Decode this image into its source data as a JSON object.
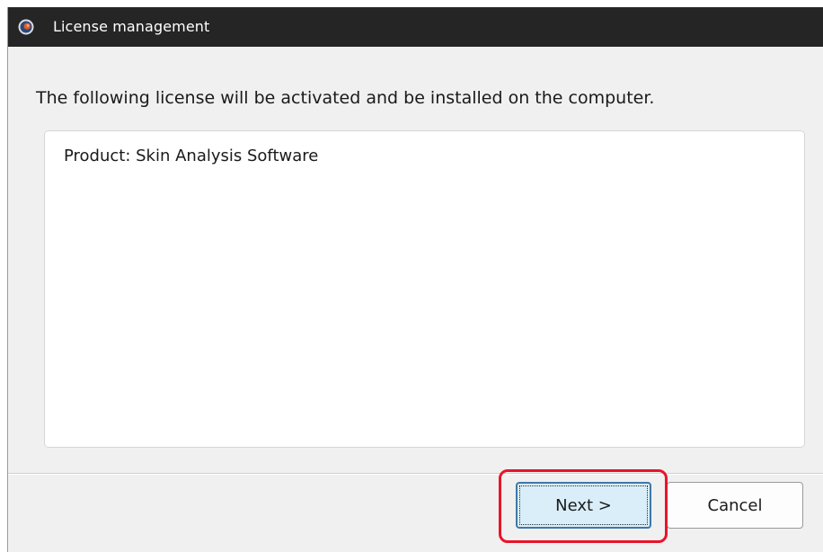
{
  "window": {
    "title": "License management",
    "icon": "app-logo-icon"
  },
  "dialog": {
    "message": "The following license will be activated and be installed on the computer.",
    "licenses": [
      "Product: Skin Analysis Software"
    ]
  },
  "buttons": {
    "next_label": "Next >",
    "cancel_label": "Cancel"
  },
  "colors": {
    "titlebar": "#252525",
    "highlight": "#e8142a",
    "next_button_bg": "#d9eef8",
    "next_button_border": "#3f78a8"
  }
}
